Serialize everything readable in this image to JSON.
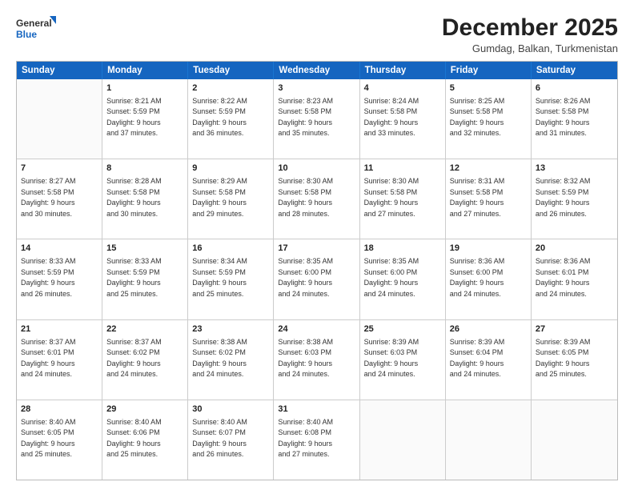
{
  "logo": {
    "line1": "General",
    "line2": "Blue"
  },
  "header": {
    "month": "December 2025",
    "location": "Gumdag, Balkan, Turkmenistan"
  },
  "weekdays": [
    "Sunday",
    "Monday",
    "Tuesday",
    "Wednesday",
    "Thursday",
    "Friday",
    "Saturday"
  ],
  "weeks": [
    [
      {
        "day": "",
        "sunrise": "",
        "sunset": "",
        "daylight": ""
      },
      {
        "day": "1",
        "sunrise": "Sunrise: 8:21 AM",
        "sunset": "Sunset: 5:59 PM",
        "daylight": "Daylight: 9 hours and 37 minutes."
      },
      {
        "day": "2",
        "sunrise": "Sunrise: 8:22 AM",
        "sunset": "Sunset: 5:59 PM",
        "daylight": "Daylight: 9 hours and 36 minutes."
      },
      {
        "day": "3",
        "sunrise": "Sunrise: 8:23 AM",
        "sunset": "Sunset: 5:58 PM",
        "daylight": "Daylight: 9 hours and 35 minutes."
      },
      {
        "day": "4",
        "sunrise": "Sunrise: 8:24 AM",
        "sunset": "Sunset: 5:58 PM",
        "daylight": "Daylight: 9 hours and 33 minutes."
      },
      {
        "day": "5",
        "sunrise": "Sunrise: 8:25 AM",
        "sunset": "Sunset: 5:58 PM",
        "daylight": "Daylight: 9 hours and 32 minutes."
      },
      {
        "day": "6",
        "sunrise": "Sunrise: 8:26 AM",
        "sunset": "Sunset: 5:58 PM",
        "daylight": "Daylight: 9 hours and 31 minutes."
      }
    ],
    [
      {
        "day": "7",
        "sunrise": "Sunrise: 8:27 AM",
        "sunset": "Sunset: 5:58 PM",
        "daylight": "Daylight: 9 hours and 30 minutes."
      },
      {
        "day": "8",
        "sunrise": "Sunrise: 8:28 AM",
        "sunset": "Sunset: 5:58 PM",
        "daylight": "Daylight: 9 hours and 30 minutes."
      },
      {
        "day": "9",
        "sunrise": "Sunrise: 8:29 AM",
        "sunset": "Sunset: 5:58 PM",
        "daylight": "Daylight: 9 hours and 29 minutes."
      },
      {
        "day": "10",
        "sunrise": "Sunrise: 8:30 AM",
        "sunset": "Sunset: 5:58 PM",
        "daylight": "Daylight: 9 hours and 28 minutes."
      },
      {
        "day": "11",
        "sunrise": "Sunrise: 8:30 AM",
        "sunset": "Sunset: 5:58 PM",
        "daylight": "Daylight: 9 hours and 27 minutes."
      },
      {
        "day": "12",
        "sunrise": "Sunrise: 8:31 AM",
        "sunset": "Sunset: 5:58 PM",
        "daylight": "Daylight: 9 hours and 27 minutes."
      },
      {
        "day": "13",
        "sunrise": "Sunrise: 8:32 AM",
        "sunset": "Sunset: 5:59 PM",
        "daylight": "Daylight: 9 hours and 26 minutes."
      }
    ],
    [
      {
        "day": "14",
        "sunrise": "Sunrise: 8:33 AM",
        "sunset": "Sunset: 5:59 PM",
        "daylight": "Daylight: 9 hours and 26 minutes."
      },
      {
        "day": "15",
        "sunrise": "Sunrise: 8:33 AM",
        "sunset": "Sunset: 5:59 PM",
        "daylight": "Daylight: 9 hours and 25 minutes."
      },
      {
        "day": "16",
        "sunrise": "Sunrise: 8:34 AM",
        "sunset": "Sunset: 5:59 PM",
        "daylight": "Daylight: 9 hours and 25 minutes."
      },
      {
        "day": "17",
        "sunrise": "Sunrise: 8:35 AM",
        "sunset": "Sunset: 6:00 PM",
        "daylight": "Daylight: 9 hours and 24 minutes."
      },
      {
        "day": "18",
        "sunrise": "Sunrise: 8:35 AM",
        "sunset": "Sunset: 6:00 PM",
        "daylight": "Daylight: 9 hours and 24 minutes."
      },
      {
        "day": "19",
        "sunrise": "Sunrise: 8:36 AM",
        "sunset": "Sunset: 6:00 PM",
        "daylight": "Daylight: 9 hours and 24 minutes."
      },
      {
        "day": "20",
        "sunrise": "Sunrise: 8:36 AM",
        "sunset": "Sunset: 6:01 PM",
        "daylight": "Daylight: 9 hours and 24 minutes."
      }
    ],
    [
      {
        "day": "21",
        "sunrise": "Sunrise: 8:37 AM",
        "sunset": "Sunset: 6:01 PM",
        "daylight": "Daylight: 9 hours and 24 minutes."
      },
      {
        "day": "22",
        "sunrise": "Sunrise: 8:37 AM",
        "sunset": "Sunset: 6:02 PM",
        "daylight": "Daylight: 9 hours and 24 minutes."
      },
      {
        "day": "23",
        "sunrise": "Sunrise: 8:38 AM",
        "sunset": "Sunset: 6:02 PM",
        "daylight": "Daylight: 9 hours and 24 minutes."
      },
      {
        "day": "24",
        "sunrise": "Sunrise: 8:38 AM",
        "sunset": "Sunset: 6:03 PM",
        "daylight": "Daylight: 9 hours and 24 minutes."
      },
      {
        "day": "25",
        "sunrise": "Sunrise: 8:39 AM",
        "sunset": "Sunset: 6:03 PM",
        "daylight": "Daylight: 9 hours and 24 minutes."
      },
      {
        "day": "26",
        "sunrise": "Sunrise: 8:39 AM",
        "sunset": "Sunset: 6:04 PM",
        "daylight": "Daylight: 9 hours and 24 minutes."
      },
      {
        "day": "27",
        "sunrise": "Sunrise: 8:39 AM",
        "sunset": "Sunset: 6:05 PM",
        "daylight": "Daylight: 9 hours and 25 minutes."
      }
    ],
    [
      {
        "day": "28",
        "sunrise": "Sunrise: 8:40 AM",
        "sunset": "Sunset: 6:05 PM",
        "daylight": "Daylight: 9 hours and 25 minutes."
      },
      {
        "day": "29",
        "sunrise": "Sunrise: 8:40 AM",
        "sunset": "Sunset: 6:06 PM",
        "daylight": "Daylight: 9 hours and 25 minutes."
      },
      {
        "day": "30",
        "sunrise": "Sunrise: 8:40 AM",
        "sunset": "Sunset: 6:07 PM",
        "daylight": "Daylight: 9 hours and 26 minutes."
      },
      {
        "day": "31",
        "sunrise": "Sunrise: 8:40 AM",
        "sunset": "Sunset: 6:08 PM",
        "daylight": "Daylight: 9 hours and 27 minutes."
      },
      {
        "day": "",
        "sunrise": "",
        "sunset": "",
        "daylight": ""
      },
      {
        "day": "",
        "sunrise": "",
        "sunset": "",
        "daylight": ""
      },
      {
        "day": "",
        "sunrise": "",
        "sunset": "",
        "daylight": ""
      }
    ]
  ]
}
